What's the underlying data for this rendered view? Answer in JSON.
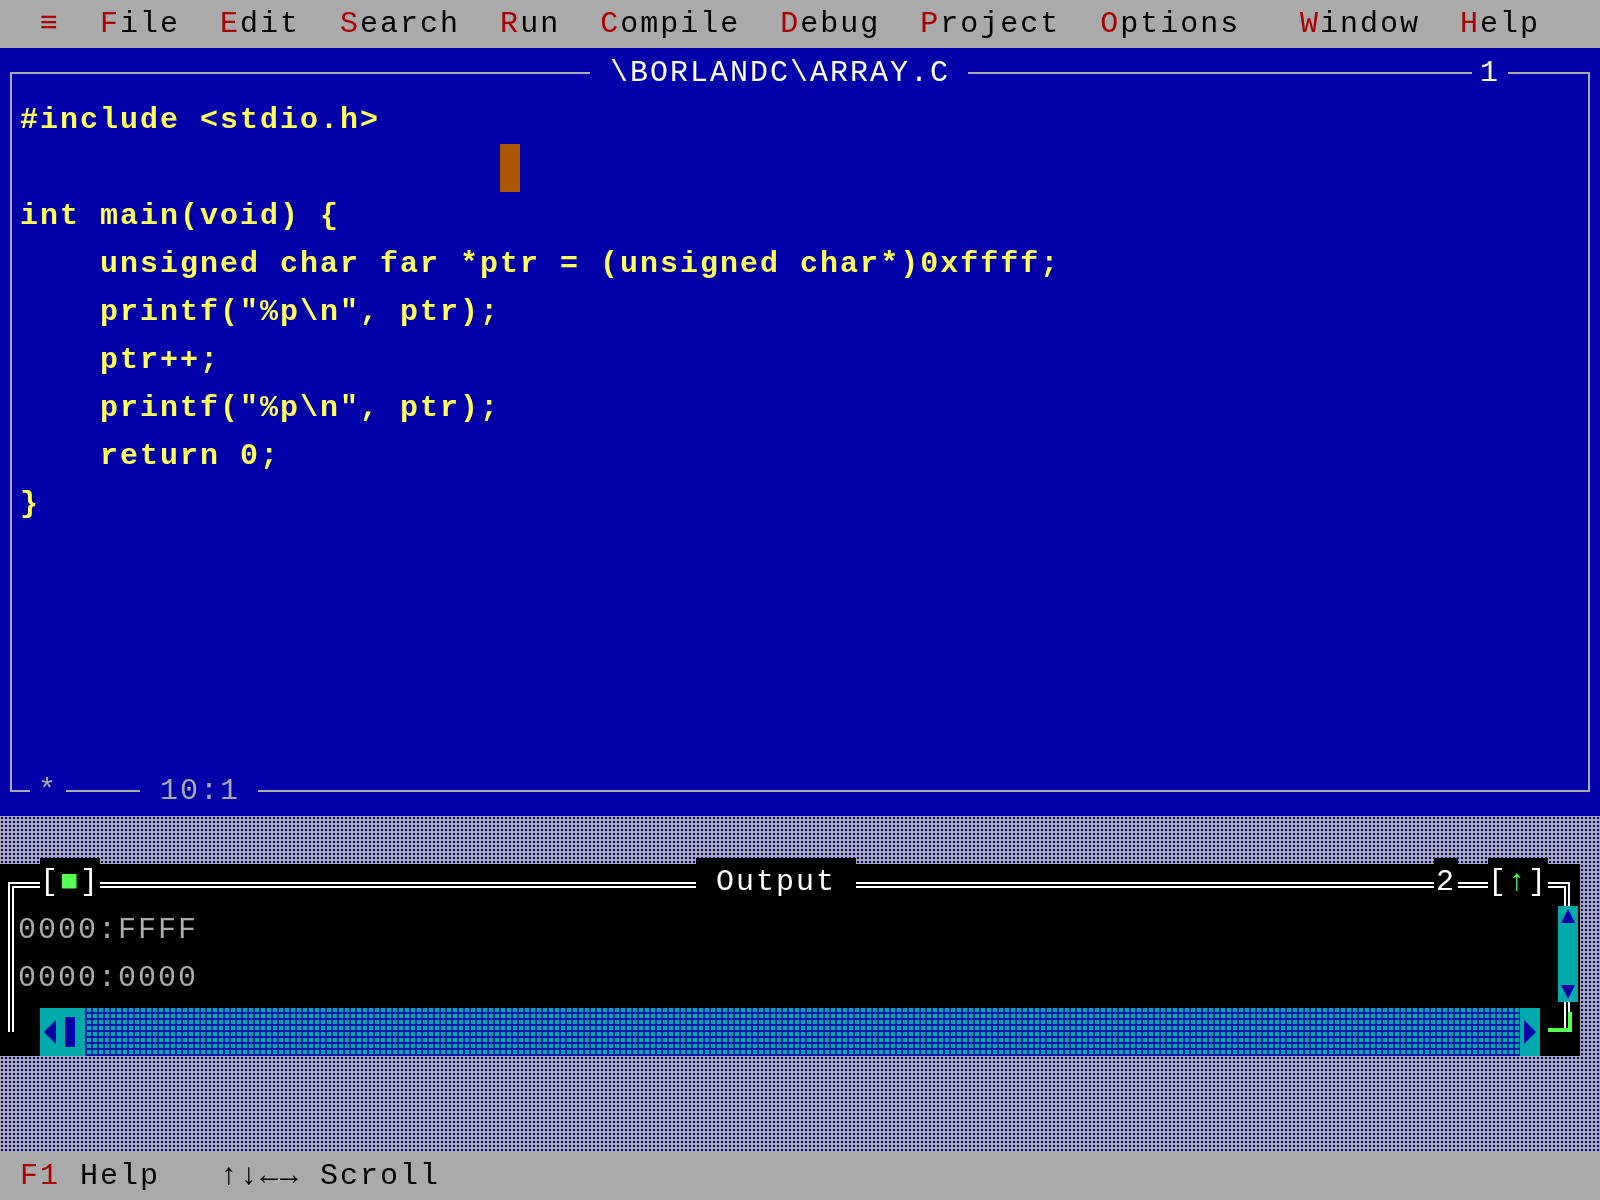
{
  "menu_left": [
    "**≡**",
    "**F**ile",
    "**E**dit",
    "**S**earch",
    "**R**un",
    "**C**ompile",
    "**D**ebug",
    "**P**roject",
    "**O**ptions"
  ],
  "menu_right": [
    "**W**indow",
    "**H**elp"
  ],
  "editor": {
    "title": "\\BORLANDC\\ARRAY.C",
    "number": "1",
    "modified": "*",
    "position": "10:1",
    "lines": [
      [
        "#include <stdio.h>"
      ],
      [
        "int main(void) {",
        "    unsigned char far *ptr = (unsigned char*)0xffff;",
        "    printf(\"%p\\n\", ptr);",
        "    ptr++;",
        "    printf(\"%p\\n\", ptr);",
        "    return 0;",
        "}"
      ]
    ]
  },
  "output": {
    "close": "[**■**]",
    "title": "Output",
    "number": "2",
    "zoom": "[**↑**]",
    "lines": [
      "0000:FFFF",
      "0000:0000"
    ]
  },
  "status": [
    {
      "text": "F1",
      "kind": "key"
    },
    {
      "text": "Help",
      "kind": "label"
    },
    {
      "text": "↑↓←→",
      "kind": "label"
    },
    {
      "text": "Scroll",
      "kind": "label"
    }
  ]
}
